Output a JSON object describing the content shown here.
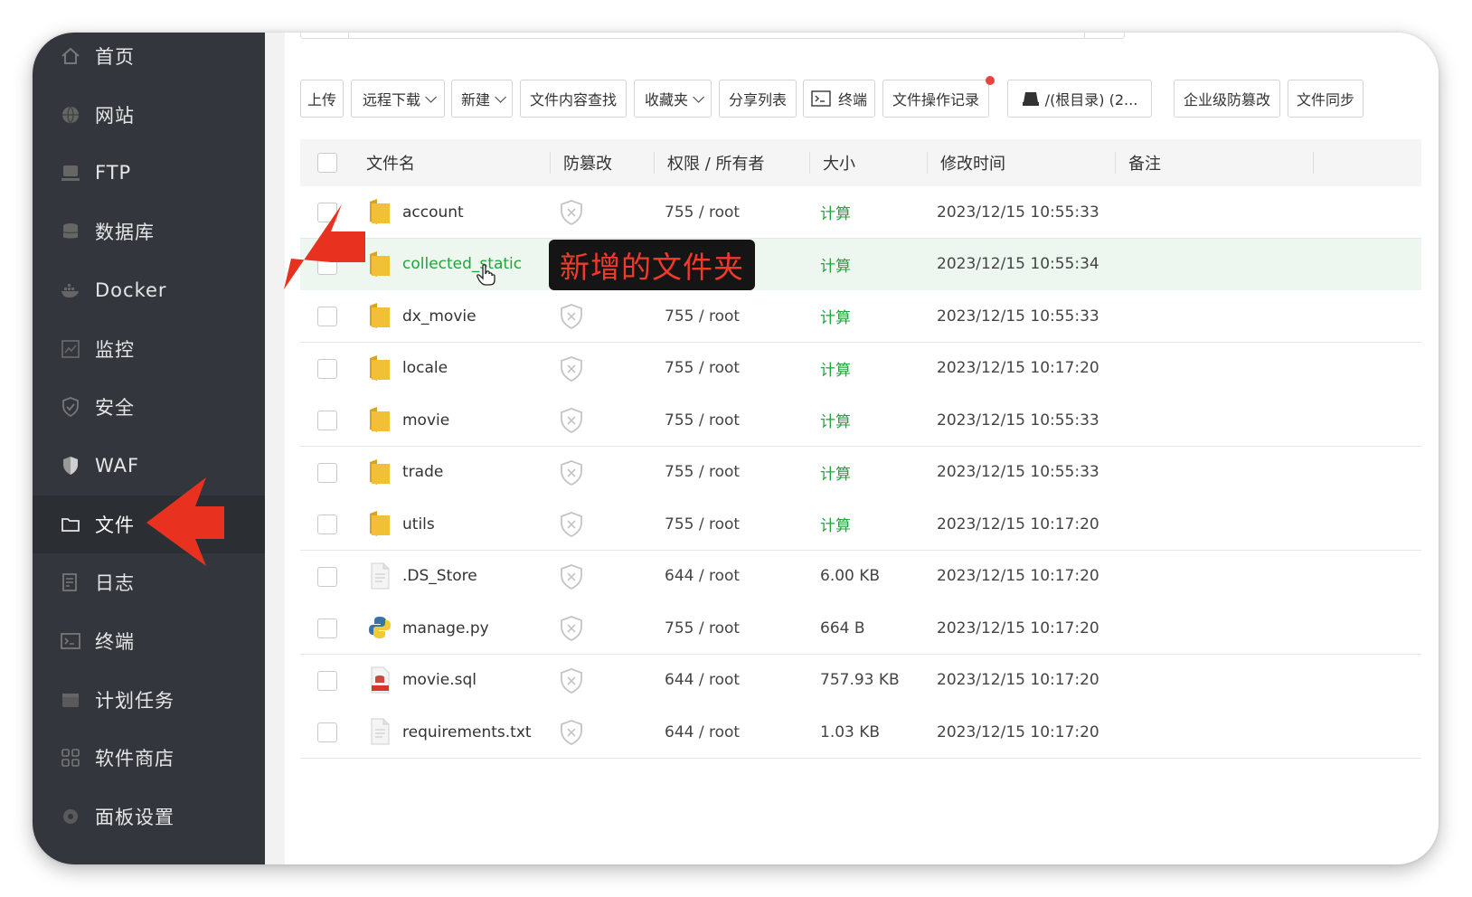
{
  "sidebar": {
    "items": [
      {
        "label": "首页",
        "icon": "home-icon"
      },
      {
        "label": "网站",
        "icon": "globe-icon"
      },
      {
        "label": "FTP",
        "icon": "ftp-icon"
      },
      {
        "label": "数据库",
        "icon": "database-icon"
      },
      {
        "label": "Docker",
        "icon": "docker-icon"
      },
      {
        "label": "监控",
        "icon": "monitor-icon"
      },
      {
        "label": "安全",
        "icon": "shield-check-icon"
      },
      {
        "label": "WAF",
        "icon": "waf-shield-icon"
      },
      {
        "label": "文件",
        "icon": "folder-icon"
      },
      {
        "label": "日志",
        "icon": "log-icon"
      },
      {
        "label": "终端",
        "icon": "terminal-icon"
      },
      {
        "label": "计划任务",
        "icon": "calendar-icon"
      },
      {
        "label": "软件商店",
        "icon": "apps-grid-icon"
      },
      {
        "label": "面板设置",
        "icon": "settings-icon"
      }
    ],
    "active_index": 8
  },
  "toolbar": {
    "upload": "上传",
    "remote_download": "远程下载",
    "new": "新建",
    "content_search": "文件内容查找",
    "favorites": "收藏夹",
    "share_list": "分享列表",
    "terminal": "终端",
    "op_log": "文件操作记录",
    "disk": "/(根目录) (2...",
    "tamper": "企业级防篡改",
    "sync": "文件同步"
  },
  "table": {
    "headers": {
      "name": "文件名",
      "tamper": "防篡改",
      "perm": "权限 / 所有者",
      "size": "大小",
      "mtime": "修改时间",
      "note": "备注"
    },
    "rows": [
      {
        "name": "account",
        "type": "folder",
        "perm": "755 / root",
        "size": "计算",
        "mtime": "2023/12/15 10:55:33"
      },
      {
        "name": "collected_static",
        "type": "folder",
        "perm": "",
        "size": "计算",
        "mtime": "2023/12/15 10:55:34",
        "highlight": true
      },
      {
        "name": "dx_movie",
        "type": "folder",
        "perm": "755 / root",
        "size": "计算",
        "mtime": "2023/12/15 10:55:33"
      },
      {
        "name": "locale",
        "type": "folder",
        "perm": "755 / root",
        "size": "计算",
        "mtime": "2023/12/15 10:17:20"
      },
      {
        "name": "movie",
        "type": "folder",
        "perm": "755 / root",
        "size": "计算",
        "mtime": "2023/12/15 10:55:33"
      },
      {
        "name": "trade",
        "type": "folder",
        "perm": "755 / root",
        "size": "计算",
        "mtime": "2023/12/15 10:55:33"
      },
      {
        "name": "utils",
        "type": "folder",
        "perm": "755 / root",
        "size": "计算",
        "mtime": "2023/12/15 10:17:20"
      },
      {
        "name": ".DS_Store",
        "type": "file",
        "perm": "644 / root",
        "size": "6.00 KB",
        "mtime": "2023/12/15 10:17:20"
      },
      {
        "name": "manage.py",
        "type": "python",
        "perm": "755 / root",
        "size": "664 B",
        "mtime": "2023/12/15 10:17:20"
      },
      {
        "name": "movie.sql",
        "type": "sql",
        "perm": "644 / root",
        "size": "757.93 KB",
        "mtime": "2023/12/15 10:17:20"
      },
      {
        "name": "requirements.txt",
        "type": "file",
        "perm": "644 / root",
        "size": "1.03 KB",
        "mtime": "2023/12/15 10:17:20"
      }
    ]
  },
  "annotation": {
    "label": "新增的文件夹"
  },
  "colors": {
    "sidebar_bg": "#33373d",
    "accent_green": "#20a53a",
    "annotation_red": "#e8321f",
    "folder_yellow": "#f2c037"
  }
}
